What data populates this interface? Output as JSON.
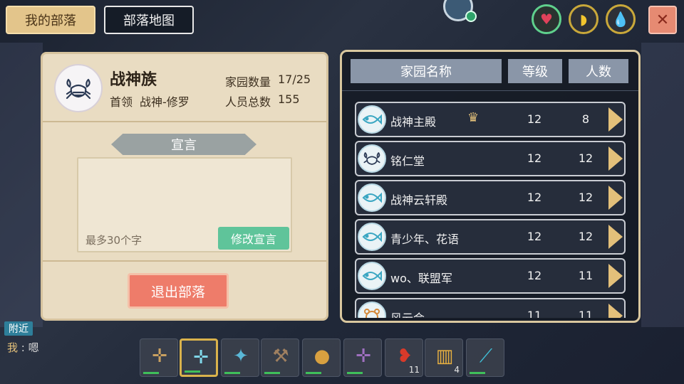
{
  "tabs": {
    "my_tribe": "我的部落",
    "tribe_map": "部落地图"
  },
  "status": {
    "heart_icon": "heart-icon",
    "hunger_icon": "banana-icon",
    "water_icon": "water-drop-icon"
  },
  "clan": {
    "name": "战神族",
    "leader_label": "首领",
    "leader_name": "战神-修罗",
    "home_count_label": "家园数量",
    "home_count": "17/25",
    "member_label": "人员总数",
    "member_count": "155"
  },
  "manifesto": {
    "title": "宣言",
    "placeholder": "最多30个字",
    "edit_label": "修改宣言"
  },
  "exit_label": "退出部落",
  "table": {
    "headers": [
      "家园名称",
      "等级",
      "人数"
    ],
    "rows": [
      {
        "name": "战神主殿",
        "level": "12",
        "count": "8",
        "emblem": "fish",
        "badge": "♛"
      },
      {
        "name": "铭仁堂",
        "level": "12",
        "count": "12",
        "emblem": "crab",
        "badge": ""
      },
      {
        "name": "战神云轩殿",
        "level": "12",
        "count": "12",
        "emblem": "fish",
        "badge": ""
      },
      {
        "name": "青少年、花语",
        "level": "12",
        "count": "12",
        "emblem": "fish",
        "badge": ""
      },
      {
        "name": "wo、联盟军",
        "level": "12",
        "count": "11",
        "emblem": "fish",
        "badge": ""
      },
      {
        "name": "风云会",
        "level": "11",
        "count": "11",
        "emblem": "bear",
        "badge": ""
      }
    ]
  },
  "chat": {
    "channel": "附近",
    "speaker": "我",
    "message": "嗯"
  },
  "hotbar": [
    {
      "icon": "crossbow-icon",
      "count": ""
    },
    {
      "icon": "ice-crossbow-icon",
      "count": ""
    },
    {
      "icon": "dragonfly-bow-icon",
      "count": ""
    },
    {
      "icon": "pickaxe-icon",
      "count": ""
    },
    {
      "icon": "gourd-icon",
      "count": ""
    },
    {
      "icon": "dark-crossbow-icon",
      "count": ""
    },
    {
      "icon": "chili-pepper-icon",
      "count": "11"
    },
    {
      "icon": "fries-icon",
      "count": "4"
    },
    {
      "icon": "crystal-staff-icon",
      "count": ""
    }
  ]
}
